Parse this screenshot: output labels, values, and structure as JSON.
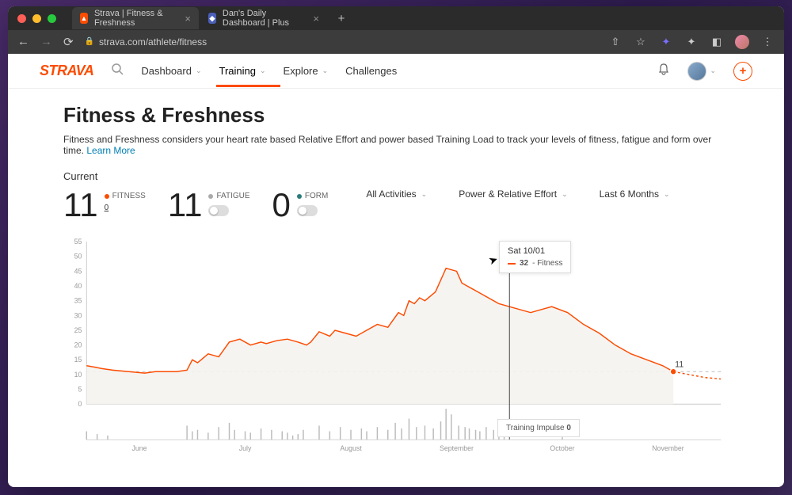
{
  "browser": {
    "tabs": [
      {
        "label": "Strava | Fitness & Freshness",
        "active": true,
        "favicon": "strava"
      },
      {
        "label": "Dan's Daily Dashboard | Plus",
        "active": false,
        "favicon": "plus"
      }
    ],
    "url": "strava.com/athlete/fitness"
  },
  "nav": {
    "logo": "STRAVA",
    "items": [
      {
        "label": "Dashboard",
        "dropdown": true,
        "active": false
      },
      {
        "label": "Training",
        "dropdown": true,
        "active": true
      },
      {
        "label": "Explore",
        "dropdown": true,
        "active": false
      },
      {
        "label": "Challenges",
        "dropdown": false,
        "active": false
      }
    ]
  },
  "page": {
    "title": "Fitness & Freshness",
    "subtitle": "Fitness and Freshness considers your heart rate based Relative Effort and power based Training Load to track your levels of fitness, fatigue and form over time. ",
    "learn_more": "Learn More",
    "current_label": "Current"
  },
  "metrics": {
    "fitness": {
      "value": "11",
      "label": "FITNESS",
      "zero": "0"
    },
    "fatigue": {
      "value": "11",
      "label": "FATIGUE"
    },
    "form": {
      "value": "0",
      "label": "FORM"
    }
  },
  "filters": {
    "activities": "All Activities",
    "metric": "Power & Relative Effort",
    "range": "Last 6 Months"
  },
  "tooltip": {
    "date": "Sat 10/01",
    "value": "32",
    "series": "- Fitness"
  },
  "impulse_box": {
    "label": "Training Impulse",
    "value": "0"
  },
  "today_label": "11",
  "chart_data": {
    "type": "line",
    "title": "Fitness & Freshness",
    "xlabel": "",
    "ylabel": "",
    "ylim": [
      0,
      55
    ],
    "y_ticks": [
      0,
      5,
      10,
      15,
      20,
      25,
      30,
      35,
      40,
      45,
      50,
      55
    ],
    "x_categories": [
      "June",
      "July",
      "August",
      "September",
      "October",
      "November"
    ],
    "cursor_date": "Sat 10/01",
    "cursor_value": 32,
    "current_fitness": 11,
    "reference_line": 11,
    "series": [
      {
        "name": "Fitness",
        "color": "#fc4c02",
        "x_month_fraction": [
          0.0,
          0.08,
          0.15,
          0.25,
          0.4,
          0.55,
          0.65,
          0.75,
          0.85,
          0.95,
          1.0,
          1.05,
          1.1,
          1.15,
          1.25,
          1.35,
          1.45,
          1.55,
          1.65,
          1.7,
          1.8,
          1.9,
          2.0,
          2.08,
          2.12,
          2.2,
          2.3,
          2.35,
          2.45,
          2.55,
          2.65,
          2.75,
          2.85,
          2.95,
          3.0,
          3.05,
          3.1,
          3.15,
          3.2,
          3.3,
          3.4,
          3.5,
          3.55,
          3.6,
          3.65,
          3.7,
          3.8,
          3.9,
          4.0,
          4.2,
          4.4,
          4.55,
          4.7,
          4.85,
          5.0,
          5.15,
          5.3,
          5.45,
          5.55
        ],
        "values": [
          13,
          12.5,
          12,
          11.5,
          11,
          10.5,
          11,
          11,
          11,
          11.5,
          15,
          14,
          15.5,
          17,
          16,
          21,
          22,
          20,
          21,
          20.5,
          21.5,
          22,
          21,
          20,
          21,
          24.5,
          23,
          25,
          24,
          23,
          25,
          27,
          26,
          31,
          30,
          35,
          34,
          36,
          35,
          38,
          46,
          45,
          41,
          40,
          39,
          38,
          36,
          34,
          33,
          31,
          33,
          31,
          27,
          24,
          20,
          17,
          15,
          13,
          11
        ]
      },
      {
        "name": "Fitness (projected)",
        "color": "#fc4c02",
        "dashed": true,
        "x_month_fraction": [
          5.55,
          5.7,
          5.85,
          6.0
        ],
        "values": [
          11,
          10,
          9,
          8.5
        ]
      }
    ],
    "impulse_bars": {
      "x_month_fraction": [
        0.0,
        0.1,
        0.2,
        0.95,
        1.0,
        1.05,
        1.15,
        1.25,
        1.35,
        1.4,
        1.5,
        1.55,
        1.65,
        1.75,
        1.85,
        1.9,
        1.95,
        2.0,
        2.05,
        2.2,
        2.3,
        2.4,
        2.5,
        2.6,
        2.65,
        2.75,
        2.85,
        2.92,
        2.98,
        3.05,
        3.12,
        3.2,
        3.28,
        3.35,
        3.4,
        3.45,
        3.52,
        3.58,
        3.62,
        3.68,
        3.72,
        3.78,
        3.85,
        3.9,
        3.95,
        4.5
      ],
      "values": [
        6,
        4,
        3,
        10,
        6,
        7,
        5,
        9,
        12,
        7,
        6,
        5,
        8,
        7,
        6,
        5,
        3,
        4,
        7,
        10,
        6,
        9,
        7,
        8,
        6,
        9,
        7,
        12,
        8,
        15,
        9,
        10,
        8,
        13,
        22,
        18,
        10,
        9,
        8,
        7,
        6,
        9,
        7,
        5,
        4,
        8
      ]
    }
  }
}
